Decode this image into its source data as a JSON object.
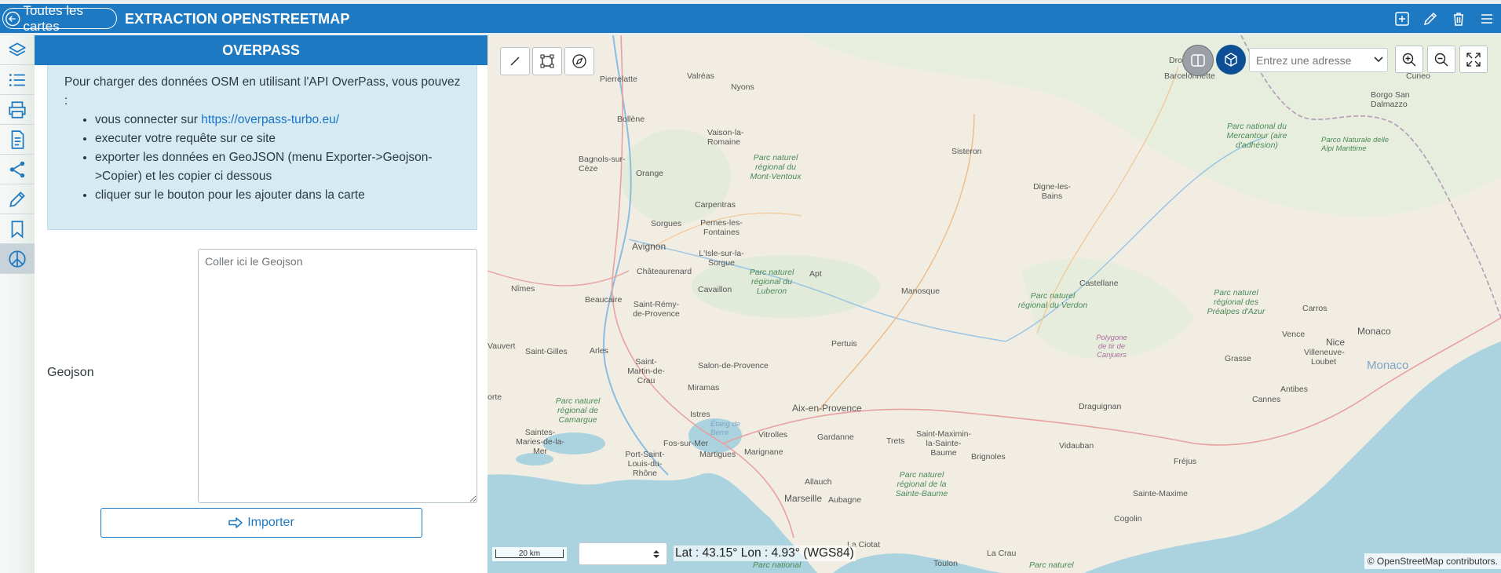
{
  "topbar": {
    "back_label": "Toutes les cartes",
    "title": "EXTRACTION OPENSTREETMAP",
    "actions": [
      "add-icon",
      "edit-icon",
      "trash-icon",
      "menu-icon"
    ],
    "color": "#1e79c3"
  },
  "rail": {
    "items": [
      "layers-icon",
      "list-icon",
      "print-icon",
      "document-icon",
      "share-icon",
      "pencil-icon",
      "bookmark-icon",
      "peace-icon"
    ],
    "active": "peace-icon"
  },
  "panel": {
    "header": "OVERPASS",
    "intro": "Pour charger des données OSM en utilisant l'API OverPass, vous pouvez :",
    "steps": {
      "s1_prefix": "vous connecter sur ",
      "s1_link": "https://overpass-turbo.eu/",
      "s2": "executer votre requête sur ce site",
      "s3": "exporter les données en GeoJSON (menu Exporter->Geojson->Copier) et les copier ci dessous",
      "s4": "cliquer sur le bouton pour les ajouter dans la carte"
    },
    "geojson_label": "Geojson",
    "geojson_placeholder": "Coller ici le Geojson",
    "geojson_value": "",
    "import_label": "Importer"
  },
  "map": {
    "tools": [
      "line-icon",
      "select-box-icon",
      "compass-icon"
    ],
    "view_buttons": [
      "split-view-icon",
      "3d-cube-icon"
    ],
    "address_placeholder": "Entrez une adresse",
    "zoom_in": "zoom-in-icon",
    "zoom_out": "zoom-out-icon",
    "fullscreen": "fullscreen-icon",
    "scale_label": "20 km",
    "projection_value": "",
    "coords": "Lat : 43.15° Lon : 4.93° (WGS84)",
    "attribution": "© OpenStreetMap contributors.",
    "labels": {
      "drones": "Drones",
      "barcelonnette": "Barcelonnette",
      "valreas": "Valréas",
      "nyons": "Nyons",
      "pierrelatte": "Pierrelatte",
      "bollene": "Bollène",
      "vaison": "Vaison-la-Romaine",
      "borgo": "Borgo San Dalmazzo",
      "cuneo": "Cuneo",
      "pn_mercantour": "Parc national du Mercantour (aire d'adhésion)",
      "pn_alpi": "Parco Naturale delle Alpi Marittime",
      "bagnols": "Bagnols-sur-Cèze",
      "orange": "Orange",
      "sisteron": "Sisteron",
      "pnr_ventoux": "Parc naturel régional du Mont-Ventoux",
      "digne": "Digne-les-Bains",
      "carpentras": "Carpentras",
      "sorgues": "Sorgues",
      "pernes": "Pernes-les-Fontaines",
      "avignon": "Avignon",
      "isle": "L'Isle-sur-la-Sorgue",
      "chateaurenard": "Châteaurenard",
      "apt": "Apt",
      "pnr_luberon": "Parc naturel régional du Luberon",
      "nimes": "Nîmes",
      "cavaillon": "Cavaillon",
      "beaucaire": "Beaucaire",
      "st_remy": "Saint-Rémy-de-Provence",
      "manosque": "Manosque",
      "castellane": "Castellane",
      "pnr_verdon": "Parc naturel régional du Verdon",
      "pnr_prealpes": "Parc naturel régional des Préalpes d'Azur",
      "carros": "Carros",
      "vence": "Vence",
      "nice": "Nice",
      "monaco_city": "Monaco",
      "monaco_sea": "Monaco",
      "vauvert": "Vauvert",
      "st_gilles": "Saint-Gilles",
      "arles": "Arles",
      "pertuis": "Pertuis",
      "polygone": "Polygone de tir de Canjuers",
      "villeneuve": "Villeneuve-Loubet",
      "st_martin": "Saint-Martin-de-Crau",
      "salon": "Salon-de-Provence",
      "grasse": "Grasse",
      "antibes": "Antibes",
      "cannes": "Cannes",
      "miramas": "Miramas",
      "pnr_camargue": "Parc naturel régional de Camargue",
      "istres": "Istres",
      "etang": "Étang de Berre",
      "aix": "Aix-en-Provence",
      "draguignan": "Draguignan",
      "stes_maries": "Saintes-Maries-de-la-Mer",
      "vitrolles": "Vitrolles",
      "gardanne": "Gardanne",
      "trets": "Trets",
      "st_maximin": "Saint-Maximin-la-Sainte-Baume",
      "fos": "Fos-sur-Mer",
      "martigues": "Martigues",
      "marignane": "Marignane",
      "vidauban": "Vidauban",
      "frejus": "Fréjus",
      "port_st_louis": "Port-Saint-Louis-du-Rhône",
      "brignoles": "Brignoles",
      "allauch": "Allauch",
      "pnr_baume": "Parc naturel régional de la Sainte-Baume",
      "marseille": "Marseille",
      "aubagne": "Aubagne",
      "ste_maxime": "Sainte-Maxime",
      "cogolin": "Cogolin",
      "la_ciotat": "La Ciotat",
      "toulon": "Toulon",
      "la_crau": "La Crau",
      "pnr_bottom1": "Parc national",
      "pnr_bottom2": "Parc naturel",
      "lorte": "orte"
    }
  }
}
